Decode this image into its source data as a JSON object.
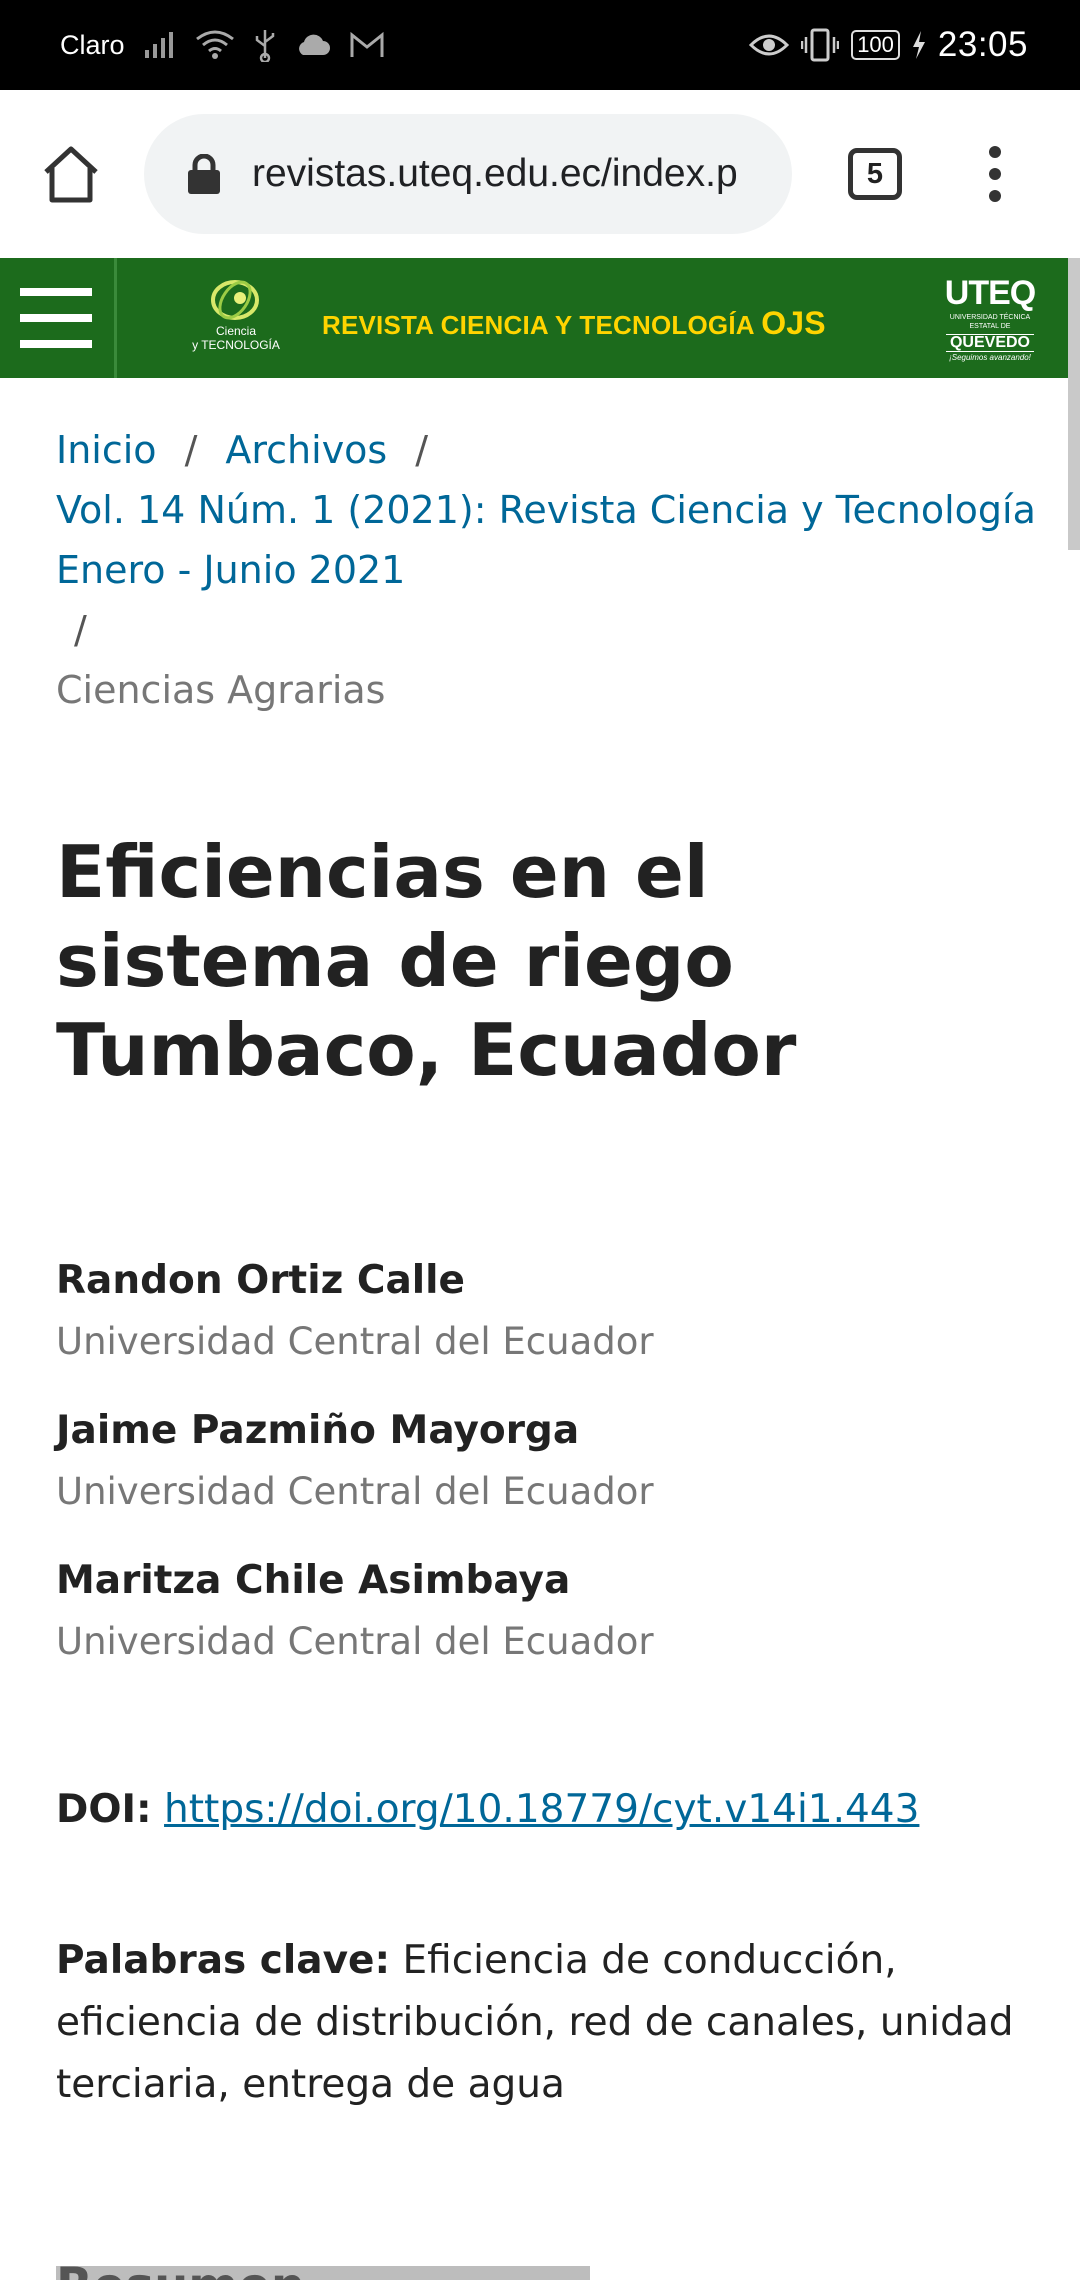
{
  "status_bar": {
    "carrier": "Claro",
    "time": "23:05",
    "battery": "100",
    "icons": [
      "signal-icon",
      "wifi-icon",
      "usb-icon",
      "cloud-icon",
      "gmail-icon",
      "eye-icon",
      "vibrate-icon",
      "battery-icon",
      "charging-icon"
    ]
  },
  "browser": {
    "url": "revistas.uteq.edu.ec/index.p",
    "tab_count": "5",
    "icons": [
      "home-icon",
      "lock-icon",
      "more-vert-icon"
    ]
  },
  "site_header": {
    "logo_caption_line1": "Ciencia",
    "logo_caption_line2": "y TECNOLOGÍA",
    "title": "REVISTA CIENCIA Y TECNOLOGÍA ",
    "title_suffix": "OJS",
    "uteq_main": "UTEQ",
    "uteq_sub": "UNIVERSIDAD TÉCNICA ESTATAL DE",
    "uteq_city": "QUEVEDO",
    "uteq_tagline": "¡Seguimos avanzando!",
    "colors": {
      "header_bg": "#1c6b1c",
      "title": "#ffd400"
    }
  },
  "breadcrumb": {
    "home": "Inicio",
    "archives": "Archivos",
    "issue": "Vol. 14 Núm. 1 (2021): Revista Ciencia y Tecnología Enero - Junio 2021",
    "current": "Ciencias Agrarias",
    "separator": "/"
  },
  "article": {
    "title": "Eficiencias en el sistema de riego Tumbaco, Ecuador",
    "authors": [
      {
        "name": "Randon Ortiz Calle",
        "affiliation": "Universidad Central del Ecuador"
      },
      {
        "name": "Jaime Pazmiño Mayorga",
        "affiliation": "Universidad Central del Ecuador"
      },
      {
        "name": "Maritza Chile Asimbaya",
        "affiliation": "Universidad Central del Ecuador"
      }
    ],
    "doi_label": "DOI:",
    "doi_url": "https://doi.org/10.18779/cyt.v14i1.443",
    "keywords_label": "Palabras clave:",
    "keywords": "Eficiencia de conducción, eficiencia de distribución, red de canales, unidad terciaria, entrega de agua",
    "next_section_peek": "Resumen"
  },
  "colors": {
    "link": "#006798",
    "muted": "#777777"
  }
}
